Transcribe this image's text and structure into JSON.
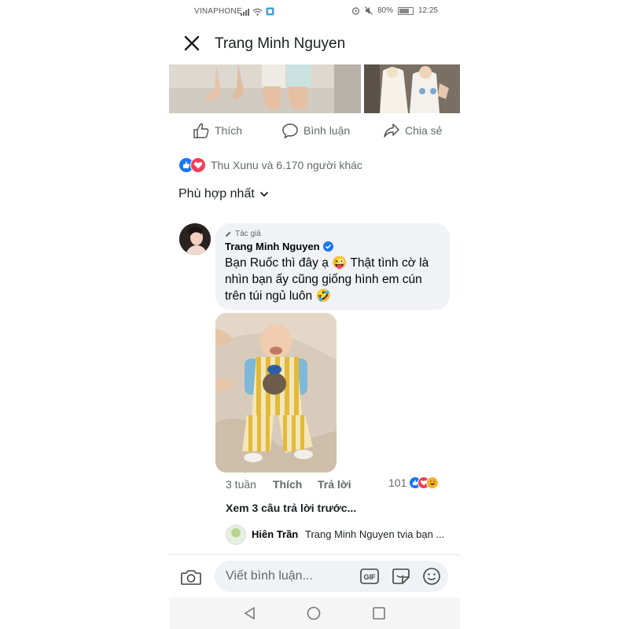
{
  "status_bar": {
    "carrier": "VINAPHONE",
    "battery": "80%",
    "time": "12:25"
  },
  "header": {
    "title": "Trang Minh Nguyen"
  },
  "post_actions": {
    "like": "Thích",
    "comment": "Bình luận",
    "share": "Chia sẻ"
  },
  "reactions": {
    "summary": "Thu Xunu và 6.170 người khác"
  },
  "sort": {
    "label": "Phù hợp nhất"
  },
  "comment": {
    "author_badge": "Tác giả",
    "author": "Trang Minh Nguyen",
    "text": "Bạn Ruốc thì đây ạ 😜 Thật tình cờ là nhìn bạn ấy cũng giống hình em cún trên túi ngủ luôn 🤣",
    "time": "3 tuần",
    "like_label": "Thích",
    "reply_label": "Trả lời",
    "reaction_count": "101"
  },
  "view_previous": "Xem 3 câu trả lời trước...",
  "reply": {
    "name": "Hiên Trần",
    "text": "Trang Minh Nguyen tvia bạn ..."
  },
  "composer": {
    "placeholder": "Viết bình luận...",
    "gif_label": "GIF"
  },
  "colors": {
    "accent": "#1877f2",
    "love": "#f33e58",
    "haha": "#f7b125",
    "bubble": "#f0f2f5"
  },
  "icons": [
    "close-icon",
    "like-icon",
    "comment-icon",
    "share-icon",
    "pencil-icon",
    "verified-icon",
    "camera-icon",
    "gif-icon",
    "sticker-icon",
    "emoji-icon",
    "nav-back-icon",
    "nav-home-icon",
    "nav-recent-icon"
  ]
}
